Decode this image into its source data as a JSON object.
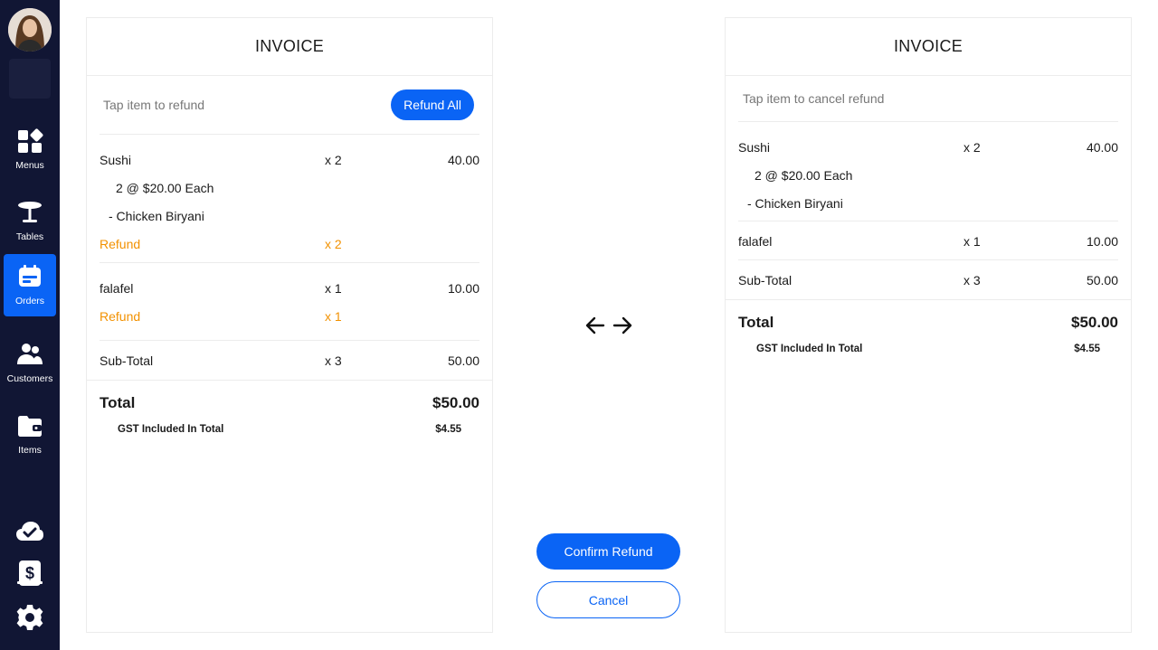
{
  "colors": {
    "sidebar_bg": "#111634",
    "accent": "#0a64f5",
    "refund": "#f29100",
    "divider": "#ececec"
  },
  "sidebar": {
    "items": [
      {
        "label": "Menus",
        "icon": "menus-icon",
        "active": false
      },
      {
        "label": "Tables",
        "icon": "table-icon",
        "active": false
      },
      {
        "label": "Orders",
        "icon": "orders-icon",
        "active": true
      },
      {
        "label": "Customers",
        "icon": "customers-icon",
        "active": false
      },
      {
        "label": "Items",
        "icon": "items-icon",
        "active": false
      }
    ],
    "bottom_icons": [
      "cloud-check-icon",
      "cash-icon",
      "gear-icon"
    ]
  },
  "left_invoice": {
    "title": "INVOICE",
    "hint": "Tap item to refund",
    "refund_all_label": "Refund All",
    "items": [
      {
        "name": "Sushi",
        "qty": "x 2",
        "amount": "40.00",
        "detail": "2 @ $20.00 Each",
        "modifier": "- Chicken Biryani",
        "refund_label": "Refund",
        "refund_qty": "x 2"
      },
      {
        "name": "falafel",
        "qty": "x 1",
        "amount": "10.00",
        "refund_label": "Refund",
        "refund_qty": "x 1"
      }
    ],
    "subtotal": {
      "label": "Sub-Total",
      "qty": "x 3",
      "amount": "50.00"
    },
    "total": {
      "label": "Total",
      "amount": "$50.00"
    },
    "gst": {
      "label": "GST Included In Total",
      "amount": "$4.55"
    }
  },
  "right_invoice": {
    "title": "INVOICE",
    "hint": "Tap item to cancel refund",
    "items": [
      {
        "name": "Sushi",
        "qty": "x 2",
        "amount": "40.00",
        "detail": "2 @ $20.00 Each",
        "modifier": "- Chicken Biryani"
      },
      {
        "name": "falafel",
        "qty": "x 1",
        "amount": "10.00"
      }
    ],
    "subtotal": {
      "label": "Sub-Total",
      "qty": "x 3",
      "amount": "50.00"
    },
    "total": {
      "label": "Total",
      "amount": "$50.00"
    },
    "gst": {
      "label": "GST Included In Total",
      "amount": "$4.55"
    }
  },
  "actions": {
    "confirm_label": "Confirm Refund",
    "cancel_label": "Cancel"
  }
}
